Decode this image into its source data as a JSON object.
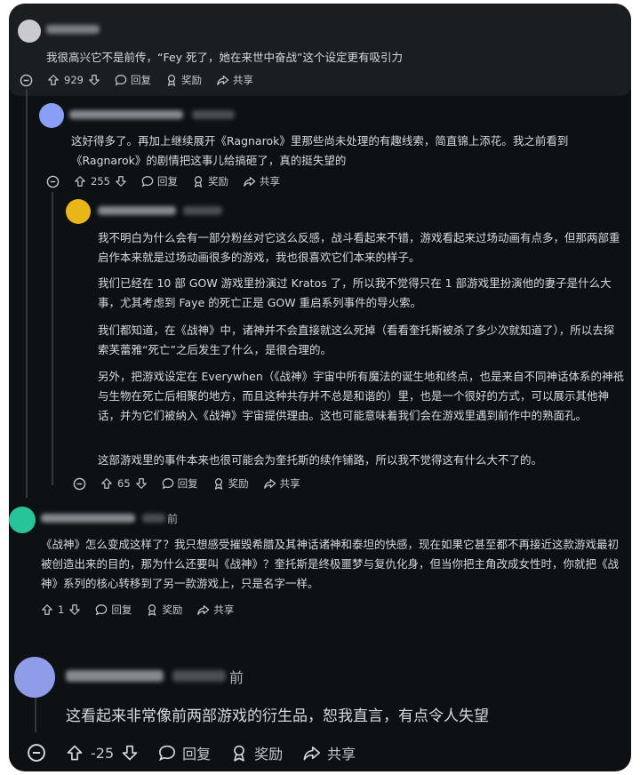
{
  "comments": [
    {
      "time_suffix": "",
      "paragraphs": [
        "我很高兴它不是前传，“Fey 死了，她在来世中奋战”这个设定更有吸引力"
      ],
      "votes": "929",
      "reply_label": "回复",
      "award_label": "奖励",
      "share_label": "共享",
      "avatar_color": "#c9c9cf"
    },
    {
      "time_suffix": "",
      "paragraphs": [
        "这好得多了。再加上继续展开《Ragnarok》里那些尚未处理的有趣线索，简直锦上添花。我之前看到《Ragnarok》的剧情把这事儿给搞砸了，真的挺失望的"
      ],
      "votes": "255",
      "reply_label": "回复",
      "award_label": "奖励",
      "share_label": "共享",
      "avatar_color": "#8a9ef5"
    },
    {
      "time_suffix": "",
      "paragraphs": [
        "我不明白为什么会有一部分粉丝对它这么反感，战斗看起来不错，游戏看起来过场动画有点多，但那两部重启作本来就是过场动画很多的游戏，我也很喜欢它们本来的样子。",
        "我们已经在 10 部 GOW 游戏里扮演过 Kratos 了，所以我不觉得只在 1 部游戏里扮演他的妻子是什么大事，尤其考虑到 Faye 的死亡正是 GOW 重启系列事件的导火索。",
        "我们都知道，在《战神》中，诸神并不会直接就这么死掉（看看奎托斯被杀了多少次就知道了），所以去探索芙蕾雅“死亡”之后发生了什么，是很合理的。",
        "另外，把游戏设定在 Everywhen（《战神》宇宙中所有魔法的诞生地和终点，也是来自不同神话体系的神祇与生物在死亡后相聚的地方，而且这种共存并不总是和谐的）里，也是一个很好的方式，可以展示其他神话，并为它们被纳入《战神》宇宙提供理由。这也可能意味着我们会在游戏里遇到前作中的熟面孔。",
        "这部游戏里的事件本来也很可能会为奎托斯的续作铺路，所以我不觉得这有什么大不了的。"
      ],
      "votes": "65",
      "reply_label": "回复",
      "award_label": "奖励",
      "share_label": "共享",
      "avatar_color": "#e8b717"
    },
    {
      "time_suffix": "前",
      "paragraphs": [
        "《战神》怎么变成这样了？我只想感受摧毁希腊及其神话诸神和泰坦的快感，现在如果它甚至都不再接近这款游戏最初被创造出来的目的，那为什么还要叫《战神》？奎托斯是终极噩梦与复仇化身，但当你把主角改成女性时，你就把《战神》系列的核心转移到了另一款游戏上，只是名字一样。"
      ],
      "votes": "1",
      "reply_label": "回复",
      "award_label": "奖励",
      "share_label": "共享",
      "avatar_color": "#27c49a"
    },
    {
      "time_suffix": "前",
      "paragraphs": [
        "这看起来非常像前两部游戏的衍生品，恕我直言，有点令人失望"
      ],
      "votes": "-25",
      "reply_label": "回复",
      "award_label": "奖励",
      "share_label": "共享",
      "avatar_color": "#8f9ce8"
    }
  ],
  "icons": {
    "collapse": "minus-circle-icon",
    "upvote": "arrow-up-icon",
    "downvote": "arrow-down-icon",
    "reply": "speech-bubble-icon",
    "award": "award-ribbon-icon",
    "share": "share-arrow-icon"
  },
  "colors": {
    "background": "#0e1113",
    "highlight_comment": "#1a1e21",
    "text": "#d7dadc"
  }
}
